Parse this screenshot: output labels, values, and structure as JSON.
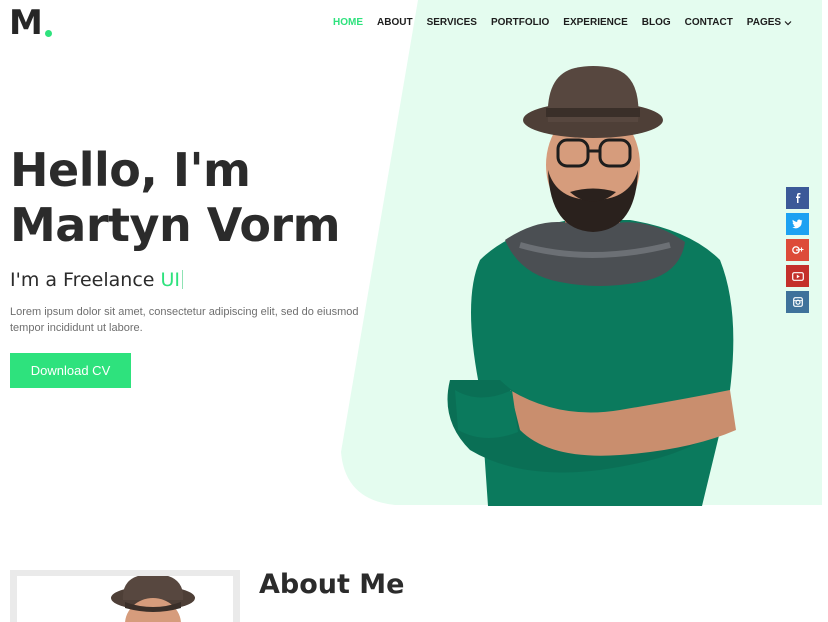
{
  "brand": {
    "logo_letter": "M",
    "dot_color": "#2ee27d"
  },
  "nav": {
    "items": [
      {
        "label": "HOME",
        "active": true
      },
      {
        "label": "ABOUT"
      },
      {
        "label": "SERVICES"
      },
      {
        "label": "PORTFOLIO"
      },
      {
        "label": "EXPERIENCE"
      },
      {
        "label": "BLOG"
      },
      {
        "label": "CONTACT"
      },
      {
        "label": "PAGES",
        "dropdown_icon": "chevron-down-icon"
      }
    ]
  },
  "hero": {
    "greeting": "Hello, I'm",
    "name": "Martyn Vorm",
    "subtitle_prefix": "I'm a Freelance ",
    "subtitle_accent": "UI",
    "description": "Lorem ipsum dolor sit amet, consectetur adipiscing elit, sed do eiusmod tempor incididunt ut labore.",
    "cta_label": "Download CV",
    "bg_color": "#e4fcef",
    "accent_color": "#2ee27d"
  },
  "social": [
    {
      "icon": "facebook-icon",
      "glyph": "f",
      "color": "#3b5998"
    },
    {
      "icon": "twitter-icon",
      "glyph": "t",
      "color": "#1da1f2"
    },
    {
      "icon": "google-plus-icon",
      "glyph": "g+",
      "color": "#dd4b39"
    },
    {
      "icon": "youtube-icon",
      "glyph": "yt",
      "color": "#c4302b"
    },
    {
      "icon": "instagram-icon",
      "glyph": "ig",
      "color": "#3f729b"
    }
  ],
  "about": {
    "title": "About Me"
  }
}
